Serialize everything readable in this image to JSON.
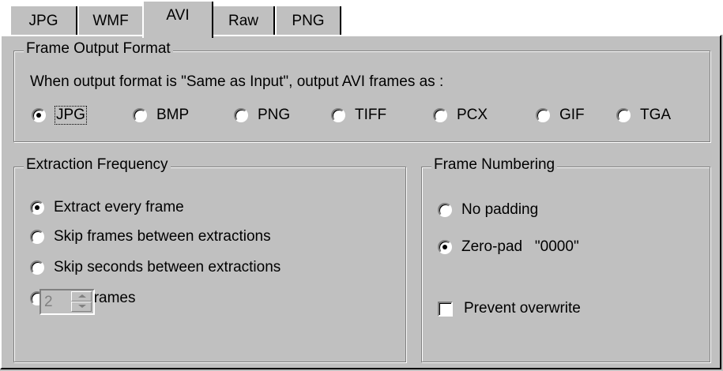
{
  "tabs": [
    {
      "label": "JPG"
    },
    {
      "label": "WMF"
    },
    {
      "label": "AVI"
    },
    {
      "label": "Raw"
    },
    {
      "label": "PNG"
    }
  ],
  "frame_output": {
    "legend": "Frame Output Format",
    "instruction": "When output format is \"Same as Input\", output AVI frames as :",
    "options": [
      {
        "label": "JPG",
        "selected": true
      },
      {
        "label": "BMP",
        "selected": false
      },
      {
        "label": "PNG",
        "selected": false
      },
      {
        "label": "TIFF",
        "selected": false
      },
      {
        "label": "PCX",
        "selected": false
      },
      {
        "label": "GIF",
        "selected": false
      },
      {
        "label": "TGA",
        "selected": false
      }
    ]
  },
  "extraction": {
    "legend": "Extraction Frequency",
    "options": [
      {
        "label": "Extract every frame",
        "selected": true
      },
      {
        "label": "Skip frames between extractions",
        "selected": false
      },
      {
        "label": "Skip seconds between extractions",
        "selected": false
      },
      {
        "label": "Total frames",
        "selected": false
      }
    ],
    "spin_value": "2"
  },
  "numbering": {
    "legend": "Frame Numbering",
    "options": [
      {
        "label": "No padding",
        "selected": false
      },
      {
        "label": "Zero-pad   \"0000\"",
        "selected": true
      }
    ],
    "checkbox_label": "Prevent overwrite",
    "checkbox_checked": false
  }
}
